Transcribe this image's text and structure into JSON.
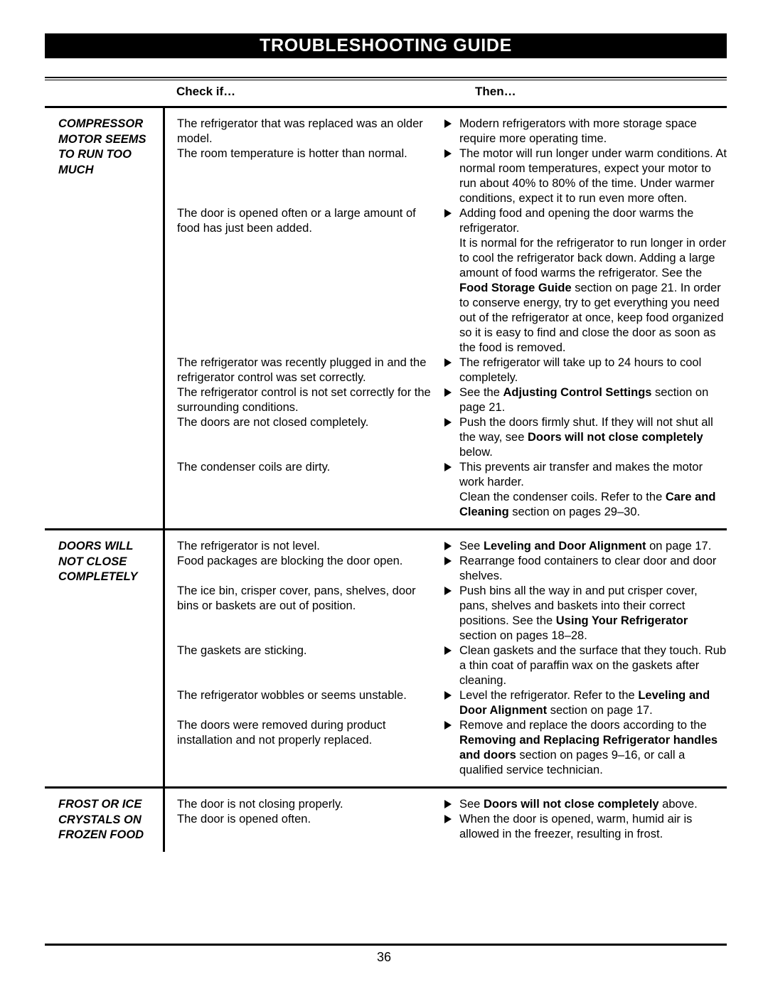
{
  "document": {
    "title": "TROUBLESHOOTING GUIDE",
    "page_number": "36"
  },
  "table": {
    "headers": {
      "check": "Check if…",
      "then": "Then…"
    },
    "sections": [
      {
        "label_lines": [
          "COMPRESSOR",
          "MOTOR SEEMS",
          "TO RUN TOO",
          "MUCH"
        ],
        "rows": [
          {
            "check": "The refrigerator that was replaced was an older model.",
            "then_html": "Modern refrigerators with more storage space require more operating time."
          },
          {
            "check": "The room temperature is hotter than normal.",
            "then_html": "The motor will run longer under warm conditions. At normal room temperatures, expect your motor to run about 40% to 80% of the time. Under warmer conditions, expect it to run even more often."
          },
          {
            "check": "The door is opened often or a large amount of food has just been added.",
            "then_html": "Adding food and opening the door warms the refrigerator.<br>It is normal for the refrigerator to run longer in order to cool the refrigerator back down. Adding a large amount of food warms the refrigerator. See the <b>Food Storage Guide</b> section on page 21. In order to conserve energy, try to get everything you need out of the refrigerator at once, keep food organized so it is easy to find and close the door as soon as the food is removed."
          },
          {
            "check": "The refrigerator was recently plugged in and the refrigerator control was set correctly.",
            "then_html": "The refrigerator will take up to 24 hours to cool completely."
          },
          {
            "check": "The refrigerator control is not set correctly for the surrounding conditions.",
            "then_html": "See the <b>Adjusting Control Settings</b> section on page 21."
          },
          {
            "check": "The doors are not closed completely.",
            "then_html": "Push the doors firmly shut. If they will not shut all the way, see <b>Doors will not close completely</b> below."
          },
          {
            "check": "The condenser coils are dirty.",
            "then_html": "This prevents air transfer and makes the motor work harder.<br>Clean the condenser coils. Refer to the <b>Care and Cleaning</b> section on pages 29–30."
          }
        ]
      },
      {
        "label_lines": [
          "DOORS WILL",
          "NOT CLOSE",
          "COMPLETELY"
        ],
        "rows": [
          {
            "check": "The refrigerator is not level.",
            "then_html": "See <b>Leveling and Door Alignment</b> on page 17."
          },
          {
            "check": "Food packages are blocking the door open.",
            "then_html": "Rearrange food containers to clear door and door shelves."
          },
          {
            "check": "The ice bin, crisper cover, pans, shelves, door bins or baskets are out of position.",
            "then_html": "Push bins all the way in and put crisper cover, pans, shelves and baskets into their correct positions. See the <b>Using Your Refrigerator</b> section on pages 18–28."
          },
          {
            "check": "The gaskets are sticking.",
            "then_html": "Clean gaskets and the surface that they touch. Rub a thin coat of paraffin wax on the gaskets after cleaning."
          },
          {
            "check": "The refrigerator wobbles or seems unstable.",
            "then_html": "Level the refrigerator. Refer to the <b>Leveling and Door Alignment</b> section on page 17."
          },
          {
            "check": "The doors were removed during product installation and not properly replaced.",
            "then_html": "Remove and replace the doors according to the <b>Removing and Replacing Refrigerator handles and doors</b> section on pages 9–16, or call a qualified service technician."
          }
        ]
      },
      {
        "label_lines": [
          "FROST OR ICE",
          "CRYSTALS ON",
          "FROZEN FOOD"
        ],
        "rows": [
          {
            "check": "The door is not closing properly.",
            "then_html": "See <b>Doors will not close completely</b> above."
          },
          {
            "check": "The door is opened often.",
            "then_html": "When the door is opened, warm, humid air is allowed in the freezer, resulting in frost."
          }
        ]
      }
    ]
  }
}
